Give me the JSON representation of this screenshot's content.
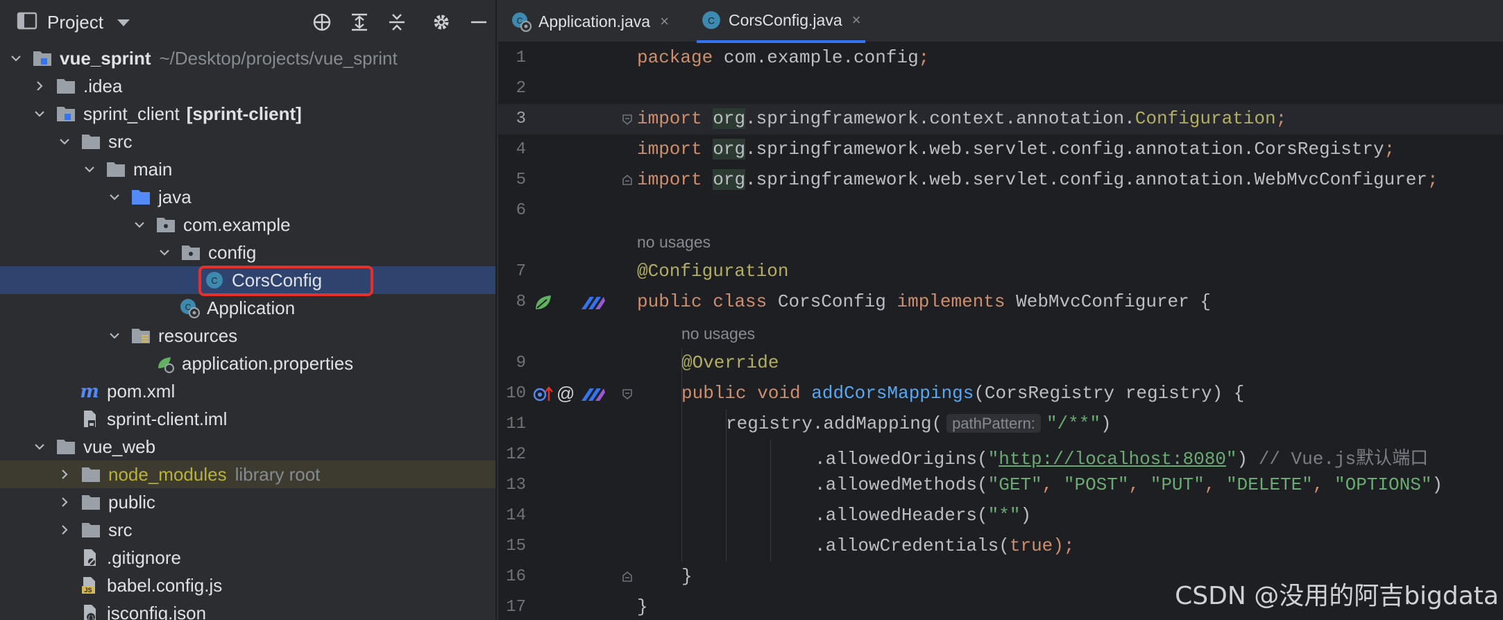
{
  "panel": {
    "title": "Project"
  },
  "tree": {
    "root_name": "vue_sprint",
    "root_path": "~/Desktop/projects/vue_sprint",
    "idea": ".idea",
    "client": "sprint_client",
    "client_module": "[sprint-client]",
    "src": "src",
    "main": "main",
    "java": "java",
    "package": "com.example",
    "config": "config",
    "cors": "CorsConfig",
    "application": "Application",
    "resources": "resources",
    "app_props": "application.properties",
    "pom": "pom.xml",
    "iml": "sprint-client.iml",
    "web": "vue_web",
    "node_modules": "node_modules",
    "library_root": "library root",
    "public": "public",
    "web_src": "src",
    "gitignore": ".gitignore",
    "babel": "babel.config.js",
    "jsconfig": "jsconfig.json"
  },
  "tabs": [
    {
      "label": "Application.java",
      "close": "×"
    },
    {
      "label": "CorsConfig.java",
      "close": "×"
    }
  ],
  "code": {
    "line_numbers": [
      "1",
      "2",
      "3",
      "4",
      "5",
      "6",
      "7",
      "8",
      "9",
      "10",
      "11",
      "12",
      "13",
      "14",
      "15",
      "16",
      "17"
    ],
    "no_usages_1": "no usages",
    "no_usages_2": "no usages",
    "l1_kw": "package",
    "l1_rest": " com.example.config",
    "semi": ";",
    "import_kw": "import",
    "org": "org",
    "l3_pkg": ".springframework.context.annotation.",
    "l3_cls": "Configuration",
    "l4_pkg": ".springframework.web.servlet.config.annotation.CorsRegistry",
    "l5_pkg": ".springframework.web.servlet.config.annotation.WebMvcConfigurer",
    "l7_ann": "@Configuration",
    "l8_public": "public",
    "l8_class": "class",
    "l8_name": " CorsConfig ",
    "l8_impl": "implements",
    "l8_iface": " WebMvcConfigurer {",
    "l9_ann": "@Override",
    "l10_public": "public",
    "l10_void": "void",
    "l10_fn": "addCorsMappings",
    "l10_args": "(CorsRegistry registry) {",
    "l11_call": "registry.addMapping(",
    "l11_hint": "pathPattern:",
    "l11_str": "\"/**\"",
    "l11_end": ")",
    "l12_call": ".allowedOrigins(",
    "l12_q1": "\"",
    "l12_url": "http://localhost:8080",
    "l12_q2": "\"",
    "l12_end": ") ",
    "l12_cmt": "// Vue.js默认端口",
    "l13_call": ".allowedMethods(",
    "l13_get": "\"GET\"",
    "l13_post": "\"POST\"",
    "l13_put": "\"PUT\"",
    "l13_delete": "\"DELETE\"",
    "l13_options": "\"OPTIONS\"",
    "comma": ", ",
    "l13_end": ")",
    "l14_call": ".allowedHeaders(",
    "l14_str": "\"*\"",
    "l14_end": ")",
    "l15_call": ".allowCredentials(",
    "l15_true": "true",
    "l15_end": ");",
    "l16": "}",
    "l17": "}"
  },
  "watermark": "CSDN @没用的阿吉bigdata",
  "colors": {
    "accent": "#3574f0",
    "highlight_box": "#e5312a",
    "selected_row": "#2e436e"
  }
}
